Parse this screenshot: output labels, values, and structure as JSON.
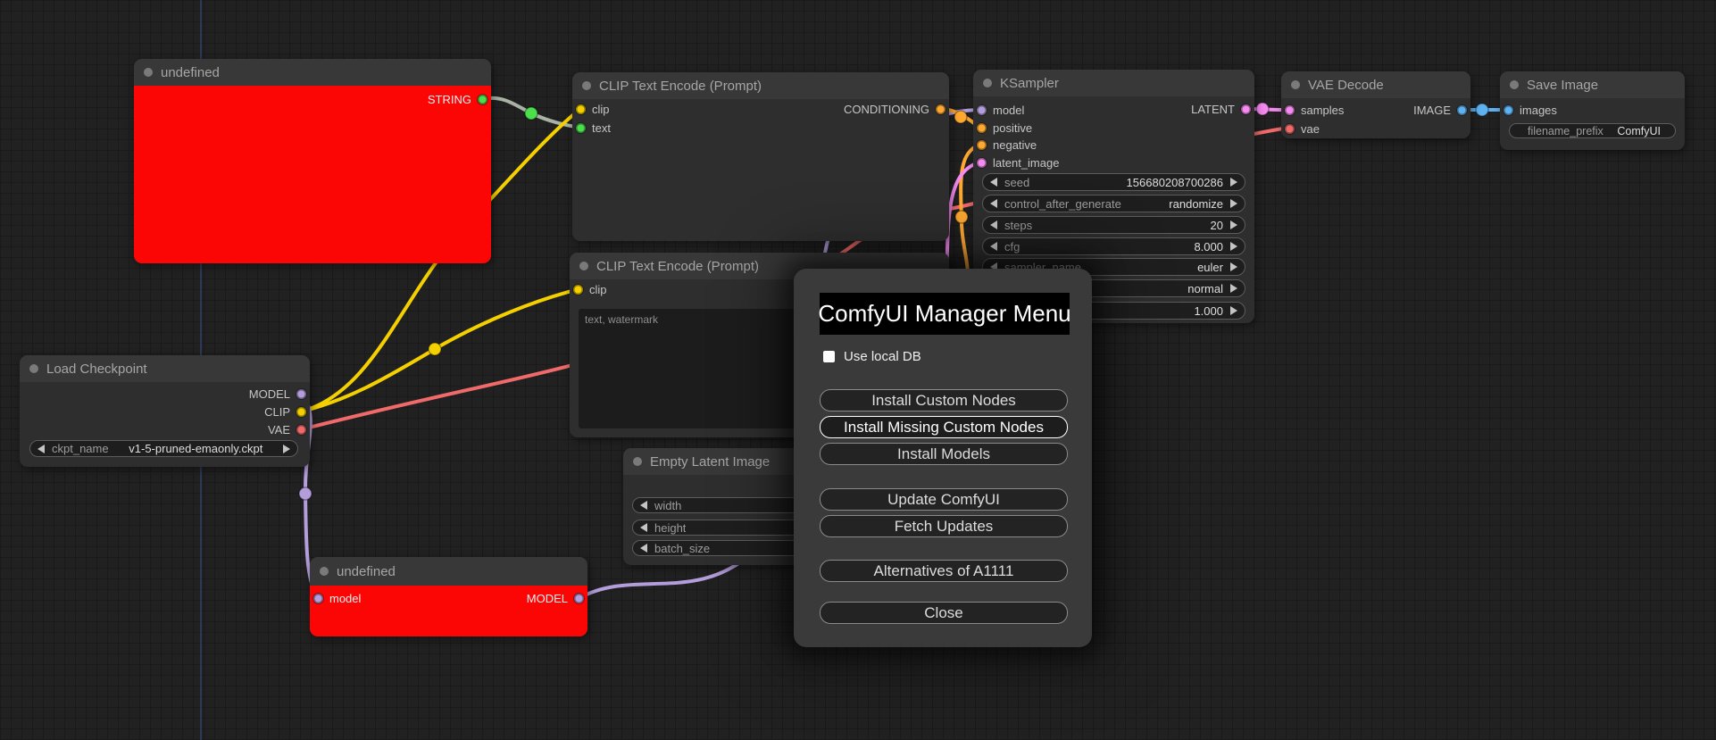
{
  "colors": {
    "canvas_bg": "#212121",
    "grid_line": "#1a1a1a",
    "axis": "#2f3d5f",
    "node_error_bg": "#fb0505",
    "links": {
      "string": "#a9b3a5",
      "clip": "#f5d000",
      "model": "#b39ddb",
      "vae": "#f16a6a",
      "conditioning": "#ffa931",
      "latent": "#f58af0",
      "image": "#5fb2f2"
    },
    "ports": {
      "string": "#4be04b",
      "clip": "#f5d000",
      "model": "#b39ddb",
      "vae": "#f16a6a",
      "conditioning": "#ffa931",
      "latent": "#f58af0",
      "image": "#5fb2f2"
    }
  },
  "nodes": {
    "red_top": {
      "title": "undefined",
      "output_label": "STRING"
    },
    "clip1": {
      "title": "CLIP Text Encode (Prompt)",
      "inputs": [
        "clip",
        "text"
      ],
      "output_label": "CONDITIONING"
    },
    "clip2": {
      "title": "CLIP Text Encode (Prompt)",
      "inputs": [
        "clip"
      ],
      "prompt_text": "text, watermark"
    },
    "ksampler": {
      "title": "KSampler",
      "inputs": [
        "model",
        "positive",
        "negative",
        "latent_image"
      ],
      "output_label": "LATENT",
      "widgets": [
        {
          "label": "seed",
          "value": "156680208700286"
        },
        {
          "label": "control_after_generate",
          "value": "randomize"
        },
        {
          "label": "steps",
          "value": "20"
        },
        {
          "label": "cfg",
          "value": "8.000"
        },
        {
          "label": "sampler_name",
          "value": "euler"
        },
        {
          "label": "",
          "value": "normal"
        },
        {
          "label": "",
          "value": "1.000"
        }
      ]
    },
    "vae_decode": {
      "title": "VAE Decode",
      "inputs": [
        "samples",
        "vae"
      ],
      "output_label": "IMAGE"
    },
    "save_image": {
      "title": "Save Image",
      "inputs": [
        "images"
      ],
      "widgets": [
        {
          "label": "filename_prefix",
          "value": "ComfyUI"
        }
      ]
    },
    "load_checkpoint": {
      "title": "Load Checkpoint",
      "outputs": [
        "MODEL",
        "CLIP",
        "VAE"
      ],
      "widgets": [
        {
          "label": "ckpt_name",
          "value": "v1-5-pruned-emaonly.ckpt"
        }
      ]
    },
    "empty_latent": {
      "title": "Empty Latent Image",
      "widgets": [
        {
          "label": "width",
          "value": ""
        },
        {
          "label": "height",
          "value": ""
        },
        {
          "label": "batch_size",
          "value": ""
        }
      ]
    },
    "red_bottom": {
      "title": "undefined",
      "input_label": "model",
      "output_label": "MODEL"
    }
  },
  "dialog": {
    "title": "ComfyUI Manager Menu",
    "checkbox_label": "Use local DB",
    "buttons": [
      {
        "label": "Install Custom Nodes"
      },
      {
        "label": "Install Missing Custom Nodes"
      },
      {
        "label": "Install Models"
      },
      {
        "label": "Update ComfyUI"
      },
      {
        "label": "Fetch Updates"
      },
      {
        "label": "Alternatives of A1111"
      },
      {
        "label": "Close"
      }
    ]
  }
}
